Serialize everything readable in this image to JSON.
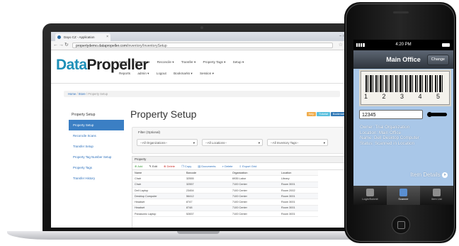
{
  "browser": {
    "tab_title": "Dayo CZ - Application",
    "url_host": "propertydemo.datapropeller.com",
    "url_path": "/inventory/InventorySetup"
  },
  "site": {
    "logo_prefix": "Data",
    "logo_suffix": "Propeller",
    "nav_top": [
      "Home",
      "Property ▾",
      "Reconcile ▾",
      "Transfer ▾",
      "Property Tags ▾",
      "Setup ▾"
    ],
    "nav_bottom": [
      "Reports",
      "admin ▾",
      "Logout",
      "Bookmarks ▾",
      "Session ▾"
    ],
    "breadcrumb": {
      "home": "Home",
      "store": "Store",
      "current": "Property Setup"
    }
  },
  "sidebar": {
    "title": "Property Setup",
    "items": [
      "Property Setup",
      "Reconcile Scans",
      "Transfer Setup",
      "Property Tag Number Setup",
      "Property Tags",
      "Transfer History"
    ]
  },
  "main": {
    "title": "Property Setup",
    "header_buttons": [
      "Help",
      "Tutorial",
      "Bookmark"
    ],
    "filter": {
      "label": "Filter (Optional)",
      "organizations": "--All Organizations--",
      "locations": "--All Locations--",
      "inventory_tags": "--All Inventory Tags--"
    },
    "table": {
      "heading": "Property",
      "toolbar": [
        "Add",
        "Edit",
        "Delete",
        "Copy",
        "Documents",
        "Delete",
        "Export Grid"
      ],
      "columns": [
        "Name",
        "Barcode",
        "Organization",
        "Location"
      ],
      "rows": [
        [
          "Chair",
          "32555",
          "6935 Labor",
          "Library"
        ],
        [
          "Chair",
          "32557",
          "7100 Center",
          "Room 3001"
        ],
        [
          "Dell Laptop",
          "23454",
          "7100 Center",
          "Room 2002"
        ],
        [
          "Desktop Computer",
          "56412",
          "7100 Center",
          "Room 3001"
        ],
        [
          "Headset",
          "8747",
          "7100 Center",
          "Room 3001"
        ],
        [
          "Headset",
          "8748",
          "7100 Center",
          "Room 3001"
        ],
        [
          "Panasonic Laptop",
          "52837",
          "7100 Center",
          "Room 3001"
        ]
      ]
    }
  },
  "phone": {
    "time": "4:20 PM",
    "nav_title": "Main Office",
    "change_label": "Change",
    "barcode_digits": "1 2 3 4 5",
    "barcode_value": "12345",
    "info": {
      "owner": "Owner: Trial Organization",
      "location": "Location: Main Office",
      "name": "Name: Dell Desktop Computer",
      "status": "Status: Scanned in Location"
    },
    "item_details": "Item Details",
    "tabs": [
      "Login/Submit",
      "Scanner",
      "Item List"
    ]
  }
}
